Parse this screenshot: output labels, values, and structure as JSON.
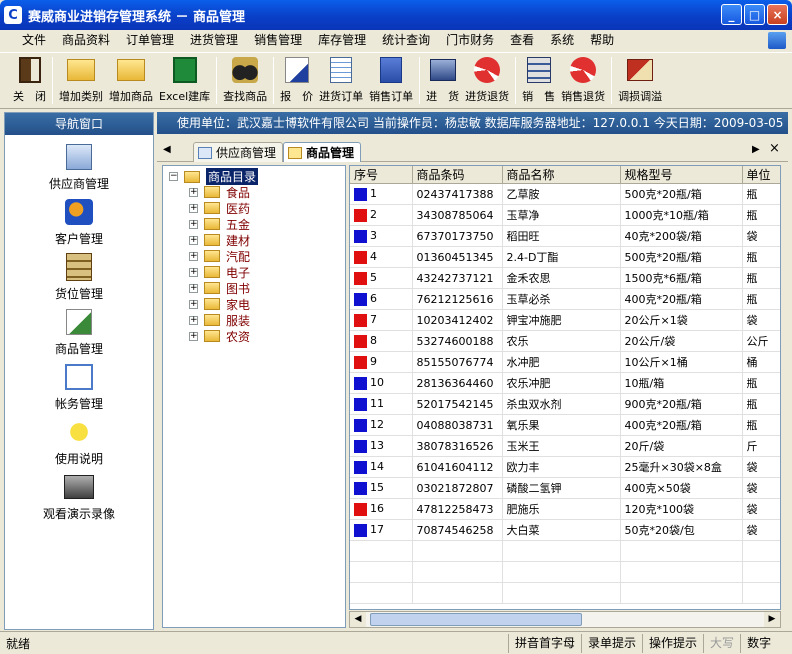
{
  "window": {
    "title": "赛威商业进销存管理系统 － 商品管理",
    "icon": "app-logo-icon",
    "min_label": "_",
    "max_label": "□",
    "close_label": "×"
  },
  "menu": [
    "文件",
    "商品资料",
    "订单管理",
    "进货管理",
    "销售管理",
    "库存管理",
    "统计查询",
    "门市财务",
    "查看",
    "系统",
    "帮助"
  ],
  "toolbar": [
    {
      "label": "关　闭",
      "icon": "door-exit-icon"
    },
    {
      "sep": true
    },
    {
      "label": "增加类别",
      "icon": "folder-icon"
    },
    {
      "label": "增加商品",
      "icon": "folder-add-icon"
    },
    {
      "label": "Excel建库",
      "icon": "excel-icon"
    },
    {
      "sep": true
    },
    {
      "label": "查找商品",
      "icon": "binoculars-icon"
    },
    {
      "sep": true
    },
    {
      "label": "报　价",
      "icon": "pen-paper-icon"
    },
    {
      "label": "进货订单",
      "icon": "order-in-icon"
    },
    {
      "label": "销售订单",
      "icon": "order-out-icon"
    },
    {
      "sep": true
    },
    {
      "label": "进　货",
      "icon": "stock-in-icon"
    },
    {
      "label": "进货退货",
      "icon": "recycle-icon"
    },
    {
      "sep": true
    },
    {
      "label": "销　售",
      "icon": "stack-icon"
    },
    {
      "label": "销售退货",
      "icon": "recycle-icon"
    },
    {
      "sep": true
    },
    {
      "label": "调损调溢",
      "icon": "book-icon"
    }
  ],
  "nav": {
    "header": "导航窗口",
    "items": [
      {
        "label": "供应商管理",
        "icon": "supplier-icon"
      },
      {
        "label": "客户管理",
        "icon": "customer-icon"
      },
      {
        "label": "货位管理",
        "icon": "shelf-icon"
      },
      {
        "label": "商品管理",
        "icon": "product-icon"
      },
      {
        "label": "帐务管理",
        "icon": "abc-icon"
      },
      {
        "label": "使用说明",
        "icon": "question-icon"
      },
      {
        "label": "观看演示录像",
        "icon": "projector-icon"
      }
    ]
  },
  "infobar": "使用单位：武汉嘉士博软件有限公司  当前操作员：杨忠敏  数据库服务器地址：127.0.0.1  今天日期：2009-03-05",
  "tabs": [
    {
      "label": "供应商管理",
      "active": false
    },
    {
      "label": "商品管理",
      "active": true
    }
  ],
  "tree": {
    "root": "商品目录",
    "children": [
      "食品",
      "医药",
      "五金",
      "建材",
      "汽配",
      "电子",
      "图书",
      "家电",
      "服装",
      "农资"
    ]
  },
  "grid": {
    "columns": [
      "序号",
      "商品条码",
      "商品名称",
      "规格型号",
      "单位"
    ],
    "rows": [
      {
        "n": "1",
        "code": "02437417388",
        "name": "乙草胺",
        "spec": "500克*20瓶/箱",
        "unit": "瓶",
        "color": "#1010D0"
      },
      {
        "n": "2",
        "code": "34308785064",
        "name": "玉草净",
        "spec": "1000克*10瓶/箱",
        "unit": "瓶",
        "color": "#E01010"
      },
      {
        "n": "3",
        "code": "67370173750",
        "name": "稻田旺",
        "spec": "40克*200袋/箱",
        "unit": "袋",
        "color": "#1010D0"
      },
      {
        "n": "4",
        "code": "01360451345",
        "name": "2.4-D丁酯",
        "spec": "500克*20瓶/箱",
        "unit": "瓶",
        "color": "#E01010"
      },
      {
        "n": "5",
        "code": "43242737121",
        "name": "金禾农思",
        "spec": "1500克*6瓶/箱",
        "unit": "瓶",
        "color": "#E01010"
      },
      {
        "n": "6",
        "code": "76212125616",
        "name": "玉草必杀",
        "spec": "400克*20瓶/箱",
        "unit": "瓶",
        "color": "#1010D0"
      },
      {
        "n": "7",
        "code": "10203412402",
        "name": "钾宝冲施肥",
        "spec": "20公斤×1袋",
        "unit": "袋",
        "color": "#E01010"
      },
      {
        "n": "8",
        "code": "53274600188",
        "name": "农乐",
        "spec": "20公斤/袋",
        "unit": "公斤",
        "color": "#E01010"
      },
      {
        "n": "9",
        "code": "85155076774",
        "name": "水冲肥",
        "spec": "10公斤×1桶",
        "unit": "桶",
        "color": "#E01010"
      },
      {
        "n": "10",
        "code": "28136364460",
        "name": "农乐冲肥",
        "spec": "10瓶/箱",
        "unit": "瓶",
        "color": "#1010D0"
      },
      {
        "n": "11",
        "code": "52017542145",
        "name": "杀虫双水剂",
        "spec": "900克*20瓶/箱",
        "unit": "瓶",
        "color": "#1010D0"
      },
      {
        "n": "12",
        "code": "04088038731",
        "name": "氧乐果",
        "spec": "400克*20瓶/箱",
        "unit": "瓶",
        "color": "#1010D0"
      },
      {
        "n": "13",
        "code": "38078316526",
        "name": "玉米王",
        "spec": "20斤/袋",
        "unit": "斤",
        "color": "#1010D0"
      },
      {
        "n": "14",
        "code": "61041604112",
        "name": "欧力丰",
        "spec": "25毫升×30袋×8盒",
        "unit": "袋",
        "color": "#1010D0"
      },
      {
        "n": "15",
        "code": "03021872807",
        "name": "磷酸二氢钾",
        "spec": "400克×50袋",
        "unit": "袋",
        "color": "#1010D0"
      },
      {
        "n": "16",
        "code": "47812258473",
        "name": "肥施乐",
        "spec": "120克*100袋",
        "unit": "袋",
        "color": "#E01010"
      },
      {
        "n": "17",
        "code": "70874546258",
        "name": "大白菜",
        "spec": "50克*20袋/包",
        "unit": "袋",
        "color": "#1010D0"
      }
    ]
  },
  "status": {
    "left": "就绪",
    "c1": "拼音首字母",
    "c2": "录单提示",
    "c3": "操作提示",
    "c4": "大写",
    "c5": "数字"
  }
}
